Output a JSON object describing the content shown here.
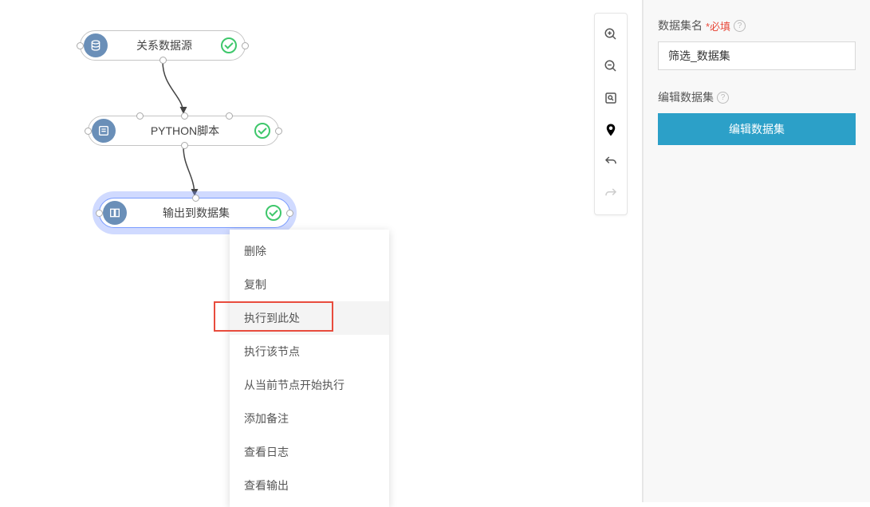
{
  "nodes": {
    "n1": {
      "label": "关系数据源"
    },
    "n2": {
      "label": "PYTHON脚本"
    },
    "n3": {
      "label": "输出到数据集"
    }
  },
  "context_menu": {
    "delete": "删除",
    "copy": "复制",
    "run_to_here": "执行到此处",
    "run_this_node": "执行该节点",
    "run_from_here": "从当前节点开始执行",
    "add_note": "添加备注",
    "view_log": "查看日志",
    "view_output": "查看输出"
  },
  "sidebar": {
    "dataset_name_label": "数据集名",
    "required_text": "*必填",
    "dataset_name_value": "筛选_数据集",
    "edit_dataset_label": "编辑数据集",
    "edit_dataset_button": "编辑数据集"
  },
  "toolbar": {
    "zoom_in": "zoom-in",
    "zoom_out": "zoom-out",
    "fit": "fit-screen",
    "locate": "locate",
    "undo": "undo",
    "redo": "redo"
  }
}
